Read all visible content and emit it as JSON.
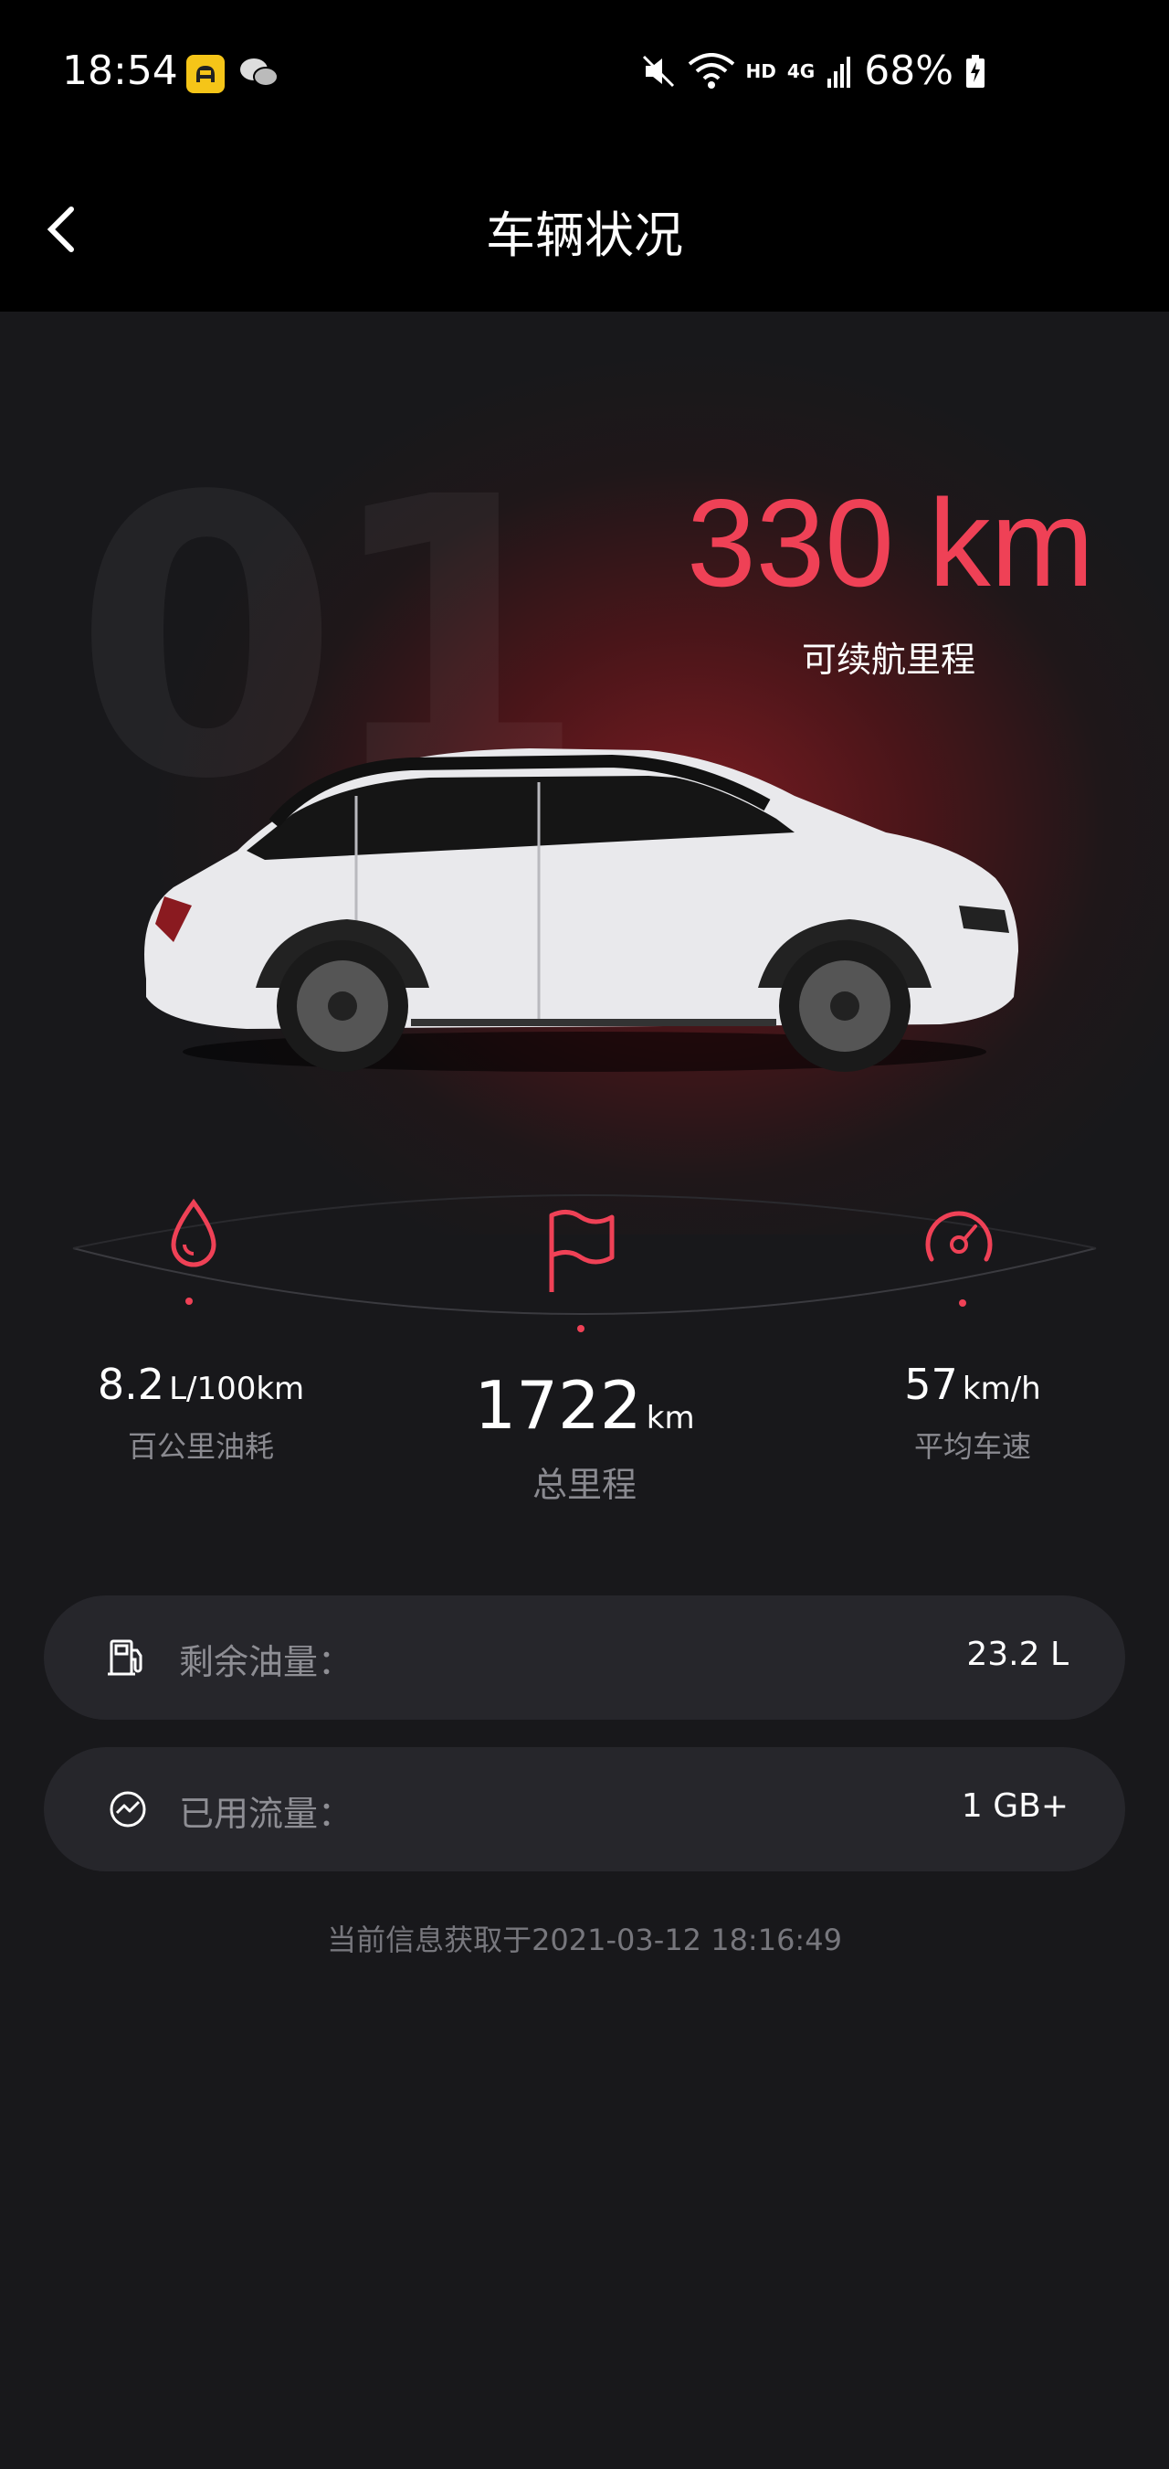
{
  "status_bar": {
    "time": "18:54",
    "network_hd": "HD",
    "network_type": "4G",
    "battery": "68%"
  },
  "header": {
    "title": "车辆状况"
  },
  "hero": {
    "watermark": "01",
    "range_value": "330 km",
    "range_label": "可续航里程",
    "accent_color": "#ef4156"
  },
  "stats": {
    "fuel_consumption": {
      "value": "8.2",
      "unit": "L/100km",
      "label": "百公里油耗",
      "icon": "droplet-icon"
    },
    "total_mileage": {
      "value": "1722",
      "unit": "km",
      "label": "总里程",
      "icon": "flag-icon"
    },
    "average_speed": {
      "value": "57",
      "unit": "km/h",
      "label": "平均车速",
      "icon": "speedometer-icon"
    }
  },
  "cards": [
    {
      "label": "剩余油量：",
      "value": "23.2 L",
      "icon": "fuel-pump-icon"
    },
    {
      "label": "已用流量：",
      "value": "1 GB+",
      "icon": "traffic-icon"
    }
  ],
  "footer": {
    "timestamp": "当前信息获取于2021-03-12 18:16:49"
  }
}
